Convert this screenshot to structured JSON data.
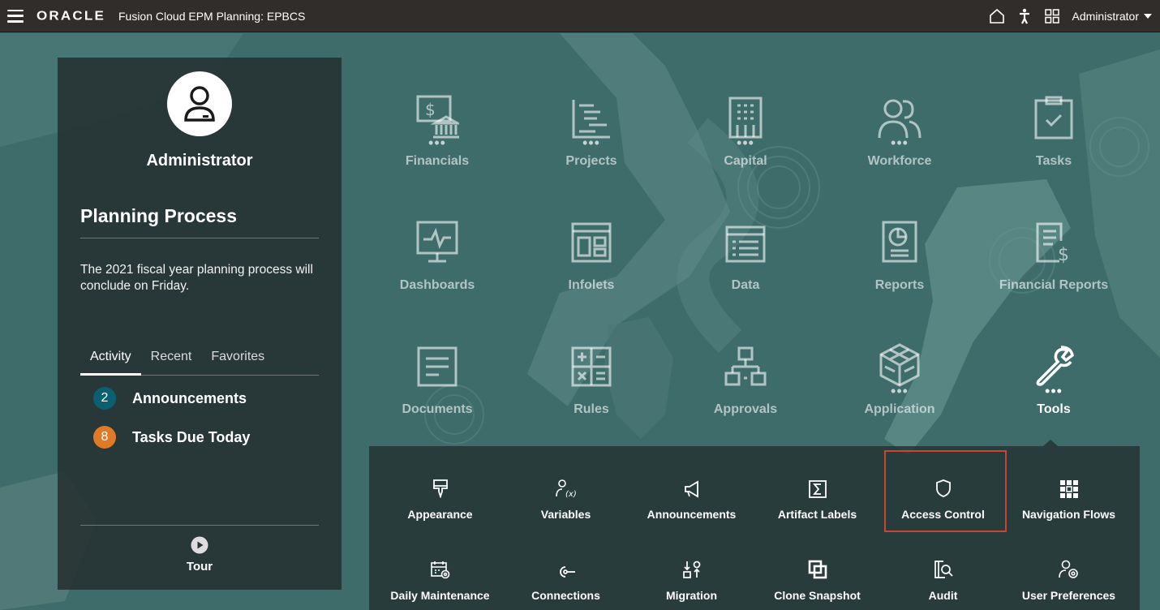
{
  "topbar": {
    "logo": "ORACLE",
    "app_title": "Fusion Cloud EPM Planning:  EPBCS",
    "user": "Administrator",
    "icons": [
      "home-icon",
      "accessibility-icon",
      "navigator-icon"
    ]
  },
  "left_panel": {
    "user_name": "Administrator",
    "process_title": "Planning Process",
    "process_text": "The 2021 fiscal year planning process will conclude on Friday.",
    "tabs": [
      {
        "label": "Activity",
        "active": true
      },
      {
        "label": "Recent",
        "active": false
      },
      {
        "label": "Favorites",
        "active": false
      }
    ],
    "activity": [
      {
        "count": "2",
        "label": "Announcements",
        "color": "#0a6071"
      },
      {
        "count": "8",
        "label": "Tasks Due Today",
        "color": "#e07a26"
      }
    ],
    "tour_label": "Tour"
  },
  "cards": [
    {
      "label": "Financials",
      "icon": "financials-icon",
      "dots": true
    },
    {
      "label": "Projects",
      "icon": "projects-icon",
      "dots": true
    },
    {
      "label": "Capital",
      "icon": "capital-icon",
      "dots": true
    },
    {
      "label": "Workforce",
      "icon": "workforce-icon",
      "dots": true
    },
    {
      "label": "Tasks",
      "icon": "tasks-icon",
      "dots": false
    },
    {
      "label": "Dashboards",
      "icon": "dashboards-icon",
      "dots": false
    },
    {
      "label": "Infolets",
      "icon": "infolets-icon",
      "dots": false
    },
    {
      "label": "Data",
      "icon": "data-icon",
      "dots": false
    },
    {
      "label": "Reports",
      "icon": "reports-icon",
      "dots": false
    },
    {
      "label": "Financial Reports",
      "icon": "financial-reports-icon",
      "dots": false
    },
    {
      "label": "Documents",
      "icon": "documents-icon",
      "dots": false
    },
    {
      "label": "Rules",
      "icon": "rules-icon",
      "dots": false
    },
    {
      "label": "Approvals",
      "icon": "approvals-icon",
      "dots": false
    },
    {
      "label": "Application",
      "icon": "application-icon",
      "dots": true
    },
    {
      "label": "Tools",
      "icon": "tools-icon",
      "dots": true,
      "active": true
    }
  ],
  "tools": [
    {
      "label": "Appearance",
      "icon": "appearance-icon"
    },
    {
      "label": "Variables",
      "icon": "variables-icon"
    },
    {
      "label": "Announcements",
      "icon": "announcements-icon"
    },
    {
      "label": "Artifact Labels",
      "icon": "artifact-labels-icon"
    },
    {
      "label": "Access Control",
      "icon": "access-control-icon",
      "highlighted": true
    },
    {
      "label": "Navigation Flows",
      "icon": "navigation-flows-icon"
    },
    {
      "label": "Daily Maintenance",
      "icon": "daily-maintenance-icon"
    },
    {
      "label": "Connections",
      "icon": "connections-icon"
    },
    {
      "label": "Migration",
      "icon": "migration-icon"
    },
    {
      "label": "Clone Snapshot",
      "icon": "clone-snapshot-icon"
    },
    {
      "label": "Audit",
      "icon": "audit-icon"
    },
    {
      "label": "User Preferences",
      "icon": "user-preferences-icon"
    }
  ],
  "colors": {
    "topbar": "#312d2a",
    "background": "#3d6b6a",
    "highlight": "#c74634"
  }
}
